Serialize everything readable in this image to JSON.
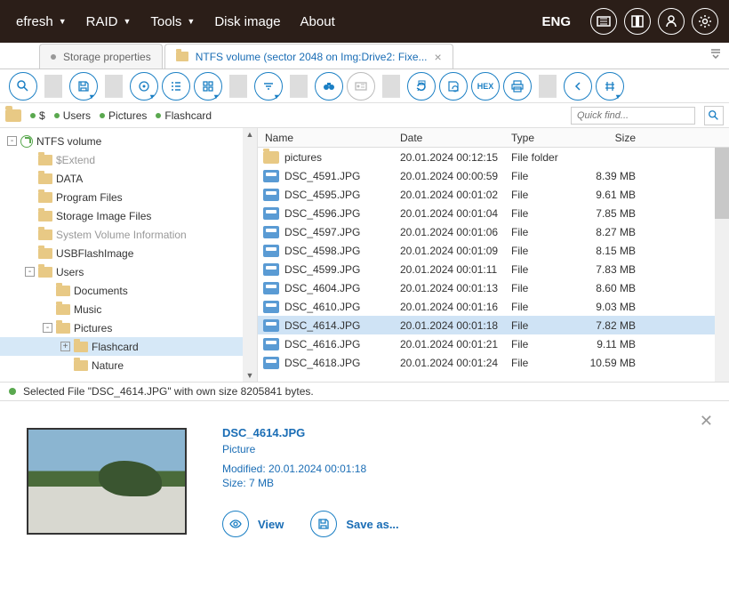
{
  "topbar": {
    "menu": [
      "efresh",
      "RAID",
      "Tools",
      "Disk image",
      "About"
    ],
    "lang": "ENG"
  },
  "tabs": {
    "t0": "Storage properties",
    "t1": "NTFS volume (sector 2048 on Img:Drive2: Fixe..."
  },
  "breadcrumb": {
    "items": [
      "$",
      "Users",
      "Pictures",
      "Flashcard"
    ]
  },
  "quickfind": {
    "placeholder": "Quick find..."
  },
  "tree": [
    {
      "lvl": 0,
      "exp": "-",
      "icon": "disk",
      "label": "NTFS volume"
    },
    {
      "lvl": 1,
      "exp": "",
      "icon": "folder",
      "label": "$Extend",
      "dim": true
    },
    {
      "lvl": 1,
      "exp": "",
      "icon": "folder",
      "label": "DATA"
    },
    {
      "lvl": 1,
      "exp": "",
      "icon": "folder",
      "label": "Program Files"
    },
    {
      "lvl": 1,
      "exp": "",
      "icon": "folder",
      "label": "Storage Image Files"
    },
    {
      "lvl": 1,
      "exp": "",
      "icon": "folder",
      "label": "System Volume Information",
      "dim": true
    },
    {
      "lvl": 1,
      "exp": "",
      "icon": "folder",
      "label": "USBFlashImage"
    },
    {
      "lvl": 1,
      "exp": "-",
      "icon": "folder",
      "label": "Users"
    },
    {
      "lvl": 2,
      "exp": "",
      "icon": "folder",
      "label": "Documents"
    },
    {
      "lvl": 2,
      "exp": "",
      "icon": "folder",
      "label": "Music"
    },
    {
      "lvl": 2,
      "exp": "-",
      "icon": "folder",
      "label": "Pictures"
    },
    {
      "lvl": 3,
      "exp": "+",
      "icon": "folder",
      "label": "Flashcard",
      "sel": true
    },
    {
      "lvl": 3,
      "exp": "",
      "icon": "folder",
      "label": "Nature"
    }
  ],
  "grid": {
    "headers": {
      "name": "Name",
      "date": "Date",
      "type": "Type",
      "size": "Size"
    },
    "rows": [
      {
        "icon": "folder",
        "name": "pictures",
        "date": "20.01.2024 00:12:15",
        "type": "File folder",
        "size": ""
      },
      {
        "icon": "img",
        "name": "DSC_4591.JPG",
        "date": "20.01.2024 00:00:59",
        "type": "File",
        "size": "8.39 MB"
      },
      {
        "icon": "img",
        "name": "DSC_4595.JPG",
        "date": "20.01.2024 00:01:02",
        "type": "File",
        "size": "9.61 MB"
      },
      {
        "icon": "img",
        "name": "DSC_4596.JPG",
        "date": "20.01.2024 00:01:04",
        "type": "File",
        "size": "7.85 MB"
      },
      {
        "icon": "img",
        "name": "DSC_4597.JPG",
        "date": "20.01.2024 00:01:06",
        "type": "File",
        "size": "8.27 MB"
      },
      {
        "icon": "img",
        "name": "DSC_4598.JPG",
        "date": "20.01.2024 00:01:09",
        "type": "File",
        "size": "8.15 MB"
      },
      {
        "icon": "img",
        "name": "DSC_4599.JPG",
        "date": "20.01.2024 00:01:11",
        "type": "File",
        "size": "7.83 MB"
      },
      {
        "icon": "img",
        "name": "DSC_4604.JPG",
        "date": "20.01.2024 00:01:13",
        "type": "File",
        "size": "8.60 MB"
      },
      {
        "icon": "img",
        "name": "DSC_4610.JPG",
        "date": "20.01.2024 00:01:16",
        "type": "File",
        "size": "9.03 MB"
      },
      {
        "icon": "img",
        "name": "DSC_4614.JPG",
        "date": "20.01.2024 00:01:18",
        "type": "File",
        "size": "7.82 MB",
        "sel": true
      },
      {
        "icon": "img",
        "name": "DSC_4616.JPG",
        "date": "20.01.2024 00:01:21",
        "type": "File",
        "size": "9.11 MB"
      },
      {
        "icon": "img",
        "name": "DSC_4618.JPG",
        "date": "20.01.2024 00:01:24",
        "type": "File",
        "size": "10.59 MB"
      }
    ]
  },
  "status": {
    "text": "Selected File \"DSC_4614.JPG\" with own size 8205841 bytes."
  },
  "preview": {
    "title": "DSC_4614.JPG",
    "sub": "Picture",
    "modified": "Modified: 20.01.2024 00:01:18",
    "size": "Size: 7 MB",
    "view": "View",
    "save": "Save as..."
  },
  "toolbar": {
    "hex": "HEX"
  }
}
